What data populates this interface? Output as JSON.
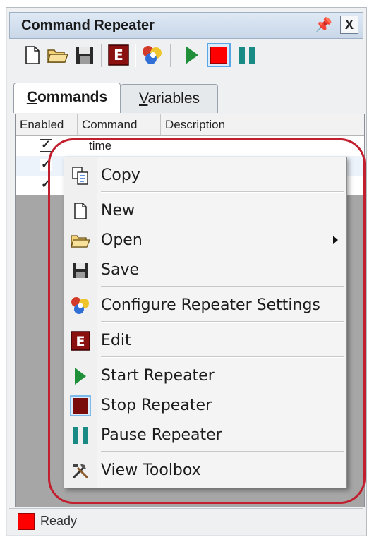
{
  "window": {
    "title": "Command Repeater",
    "pin_icon": "pin-icon",
    "close_icon": "close-icon",
    "close_label": "X"
  },
  "toolbar": {
    "buttons": [
      {
        "name": "new",
        "icon": "new-document-icon"
      },
      {
        "name": "open",
        "icon": "open-folder-icon"
      },
      {
        "name": "save",
        "icon": "save-disk-icon"
      },
      {
        "name": "edit",
        "icon": "edit-e-icon"
      },
      {
        "name": "configure",
        "icon": "configure-settings-icon"
      },
      {
        "name": "start",
        "icon": "play-icon"
      },
      {
        "name": "stop",
        "icon": "stop-icon",
        "active": true
      },
      {
        "name": "pause",
        "icon": "pause-icon"
      }
    ]
  },
  "tabs": [
    {
      "label_underlined": "C",
      "label_rest": "ommands",
      "active": true
    },
    {
      "label_underlined": "V",
      "label_rest": "ariables",
      "active": false
    }
  ],
  "grid": {
    "columns": [
      "Enabled",
      "Command",
      "Description"
    ],
    "rows": [
      {
        "enabled": true,
        "command": "time",
        "description": ""
      },
      {
        "enabled": true,
        "command": "",
        "description": ""
      },
      {
        "enabled": true,
        "command": "",
        "description": ""
      }
    ]
  },
  "context_menu": {
    "items": [
      {
        "label": "Copy",
        "icon": "copy-icon"
      },
      {
        "label": "New",
        "icon": "new-document-icon"
      },
      {
        "label": "Open",
        "icon": "open-folder-icon",
        "submenu": true
      },
      {
        "label": "Save",
        "icon": "save-disk-icon"
      },
      {
        "label": "Configure Repeater Settings",
        "icon": "configure-settings-icon"
      },
      {
        "label": "Edit",
        "icon": "edit-e-icon"
      },
      {
        "label": "Start Repeater",
        "icon": "play-icon"
      },
      {
        "label": "Stop Repeater",
        "icon": "stop-icon"
      },
      {
        "label": "Pause Repeater",
        "icon": "pause-icon"
      },
      {
        "label": "View Toolbox",
        "icon": "toolbox-icon"
      }
    ]
  },
  "status": {
    "text": "Ready",
    "indicator_color": "#ff0000"
  },
  "colors": {
    "highlight_ring": "#c21f2e",
    "play_green": "#1f8f3a",
    "stop_red": "#ff0000",
    "pause_teal": "#1a8a84",
    "edit_darkred": "#8b1010"
  }
}
